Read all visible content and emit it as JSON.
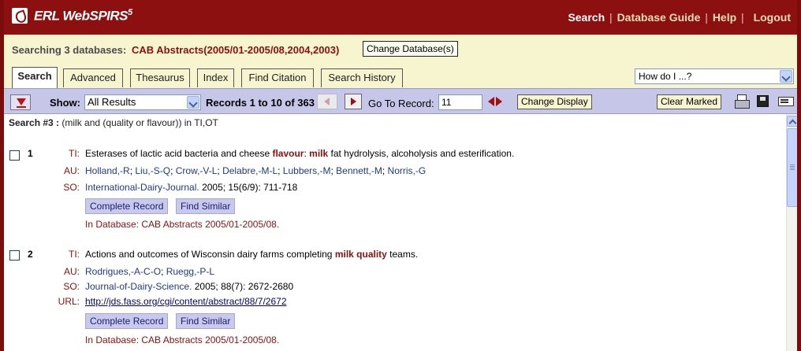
{
  "header": {
    "brand": "ERL WebSPIRS",
    "brand_version": "5",
    "nav": {
      "search": "Search",
      "database_guide": "Database Guide",
      "help": "Help",
      "logout": "Logout",
      "separator": "|"
    }
  },
  "dbbar": {
    "label": "Searching 3 databases:",
    "databases": "CAB Abstracts(2005/01-2005/08,2004,2003)",
    "change_button": "Change Database(s)"
  },
  "tabs": [
    {
      "label": "Search",
      "active": true
    },
    {
      "label": "Advanced"
    },
    {
      "label": "Thesaurus"
    },
    {
      "label": "Index"
    },
    {
      "label": "Find Citation"
    },
    {
      "label": "Search History"
    }
  ],
  "howdo": {
    "selected": "How do I ...?"
  },
  "toolbar": {
    "show_label": "Show:",
    "show_selected": "All Results",
    "records_text": "Records 1 to 10 of 363",
    "goto_label": "Go To Record:",
    "goto_value": "11",
    "change_display": "Change Display",
    "clear_marked": "Clear Marked"
  },
  "search_line": {
    "label": "Search #3 :",
    "query": "(milk and (quality or flavour)) in TI,OT"
  },
  "records": [
    {
      "number": "1",
      "ti_label": "TI:",
      "title_parts": [
        "Esterases of lactic acid bacteria and cheese ",
        "flavour",
        ": ",
        "milk",
        " fat hydrolysis, alcoholysis and esterification."
      ],
      "au_label": "AU:",
      "authors": [
        "Holland,-R",
        "Liu,-S-Q",
        "Crow,-V-L",
        "Delabre,-M-L",
        "Lubbers,-M",
        "Bennett,-M",
        "Norris,-G"
      ],
      "so_label": "SO:",
      "source_journal": "International-Dairy-Journal.",
      "source_details": " 2005; 15(6/9): 711-718",
      "complete_record": "Complete Record",
      "find_similar": "Find Similar",
      "in_database": "In Database: CAB Abstracts 2005/01-2005/08."
    },
    {
      "number": "2",
      "ti_label": "TI:",
      "title_parts": [
        "Actions and outcomes of Wisconsin dairy farms completing ",
        "milk",
        " ",
        "quality",
        " teams."
      ],
      "au_label": "AU:",
      "authors": [
        "Rodrigues,-A-C-O",
        "Ruegg,-P-L"
      ],
      "so_label": "SO:",
      "source_journal": "Journal-of-Dairy-Science.",
      "source_details": " 2005; 88(7): 2672-2680",
      "url_label": "URL:",
      "url": "http://jds.fass.org/cgi/content/abstract/88/7/2672",
      "complete_record": "Complete Record",
      "find_similar": "Find Similar",
      "in_database": "In Database: CAB Abstracts 2005/01-2005/08."
    }
  ],
  "colors": {
    "brand_red": "#8c1010",
    "cream": "#f7f4d0",
    "toolbar_lavender": "#c6c6e8",
    "link_blue": "#1f3a8a"
  }
}
